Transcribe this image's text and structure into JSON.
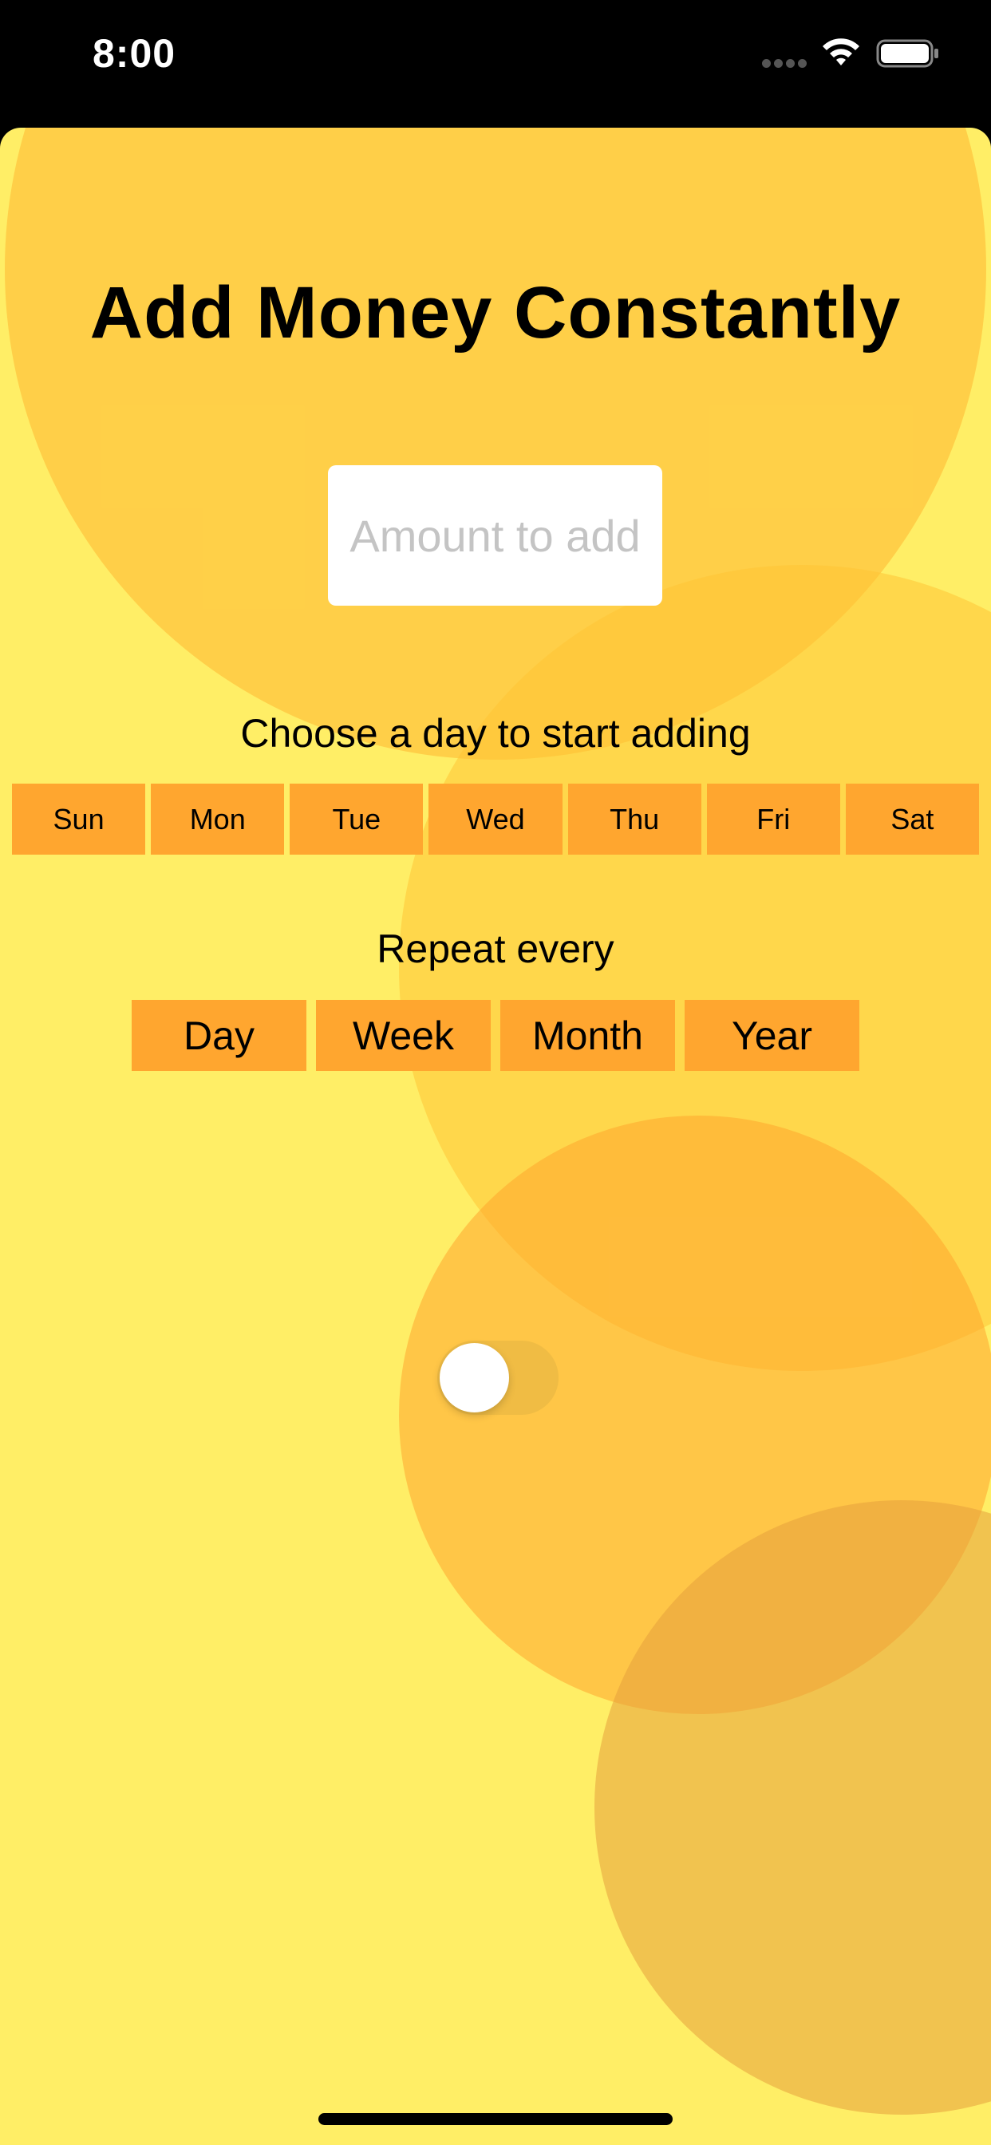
{
  "status_bar": {
    "time": "8:00",
    "icons": [
      "signal-icon",
      "wifi-icon",
      "battery-icon"
    ]
  },
  "screen": {
    "title": "Add Money Constantly",
    "amount_input": {
      "value": "",
      "placeholder": "Amount to add"
    },
    "start_day": {
      "label": "Choose a day to start adding",
      "options": [
        "Sun",
        "Mon",
        "Tue",
        "Wed",
        "Thu",
        "Fri",
        "Sat"
      ]
    },
    "repeat": {
      "label": "Repeat every",
      "options": [
        "Day",
        "Week",
        "Month",
        "Year"
      ]
    },
    "toggle": {
      "on": false
    }
  },
  "colors": {
    "background": "#FFEE66",
    "button": "#FFA62F",
    "status_bar": "#000000"
  }
}
